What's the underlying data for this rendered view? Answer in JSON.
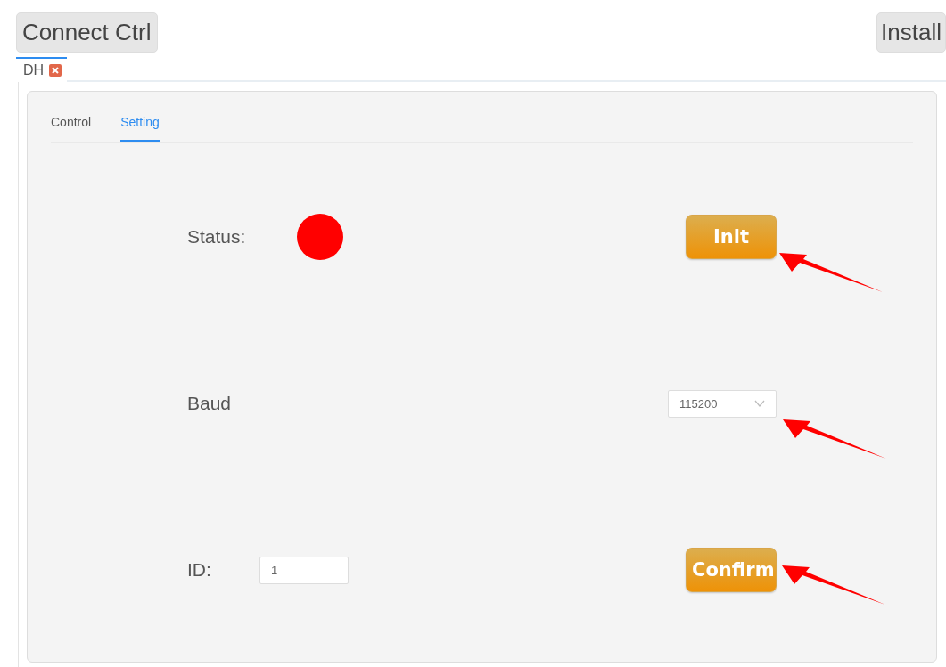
{
  "toolbar": [
    {
      "label": "Connect Ctrl"
    },
    {
      "label": "Install"
    }
  ],
  "doc_tabs": [
    {
      "label": "DH",
      "selected": true,
      "closable": true
    }
  ],
  "tabs": [
    {
      "label": "Control",
      "selected": false
    },
    {
      "label": "Setting",
      "selected": true
    }
  ],
  "rows": [
    {
      "kind": "status",
      "label": "Status:",
      "color": "#ff0000",
      "action": "Init",
      "arrow": true
    },
    {
      "kind": "select",
      "label": "Baud",
      "value": "115200",
      "arrow": true
    },
    {
      "kind": "input",
      "label": "ID:",
      "value": "1",
      "action": "Confirm",
      "arrow": true
    }
  ]
}
